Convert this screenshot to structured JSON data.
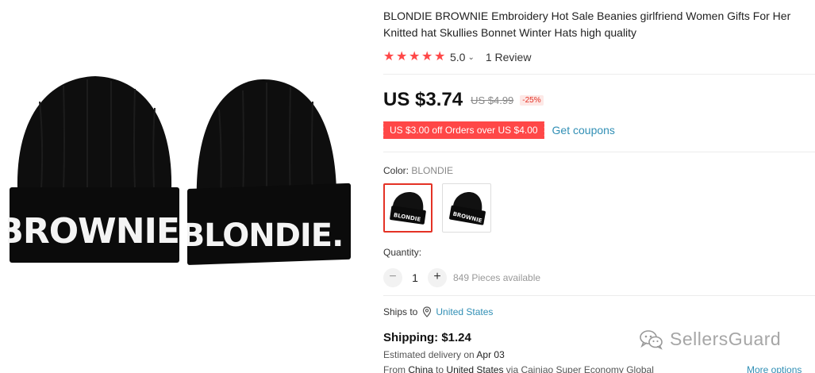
{
  "product": {
    "title": "BLONDIE BROWNIE Embroidery Hot Sale Beanies girlfriend Women Gifts For Her Knitted hat Skullies Bonnet Winter Hats high quality",
    "image_text_left": "BROWNIE.",
    "image_text_right": "BLONDIE."
  },
  "rating": {
    "stars": 5,
    "value": "5.0",
    "reviews": "1 Review",
    "star_color": "#ff4747"
  },
  "price": {
    "current": "US $3.74",
    "original": "US $4.99",
    "discount": "-25%"
  },
  "coupon": {
    "badge": "US $3.00 off Orders over US $4.00",
    "link": "Get coupons",
    "badge_color": "#ff4747"
  },
  "color": {
    "label": "Color:",
    "selected": "BLONDIE",
    "swatches": [
      {
        "text": "BLONDIE",
        "selected": true
      },
      {
        "text": "BROWNIE",
        "selected": false
      }
    ]
  },
  "quantity": {
    "label": "Quantity:",
    "minus": "−",
    "plus": "+",
    "value": "1",
    "available": "849 Pieces available"
  },
  "shipping": {
    "ships_to_label": "Ships to",
    "ships_to_country": "United States",
    "cost": "Shipping: $1.24",
    "delivery_prefix": "Estimated delivery on",
    "delivery_date": "Apr 03",
    "from_prefix": "From",
    "from_country": "China",
    "to_word": "to",
    "to_country": "United States",
    "via_text": "via Cainiao Super Economy Global",
    "more_options": "More options"
  },
  "watermark": {
    "text": "SellersGuard"
  },
  "icons": [
    "star-icon",
    "chevron-down-icon",
    "location-pin-icon",
    "wechat-logo-icon"
  ],
  "colors": {
    "link": "#318fb5",
    "accent": "#e43225"
  }
}
